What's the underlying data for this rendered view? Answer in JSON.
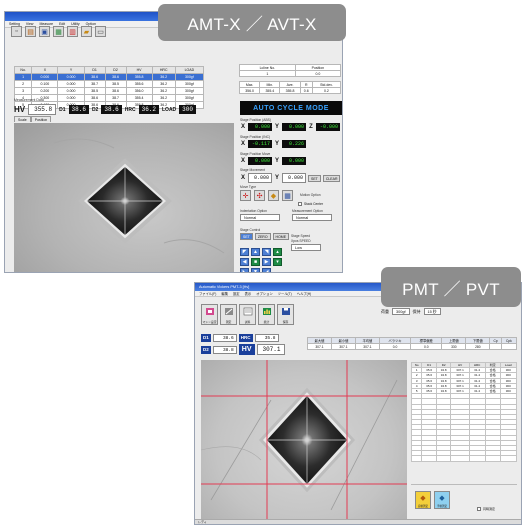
{
  "labels": {
    "top": "AMT-X ／ AVT-X",
    "bottom": "PMT ／ PVT"
  },
  "shot1": {
    "menu": [
      "Setting",
      "View",
      "Measure",
      "Edit",
      "Utility",
      "Option"
    ],
    "table_headers": [
      "No.",
      "X",
      "Y",
      "D1",
      "D2",
      "HV",
      "HRC",
      "LOAD"
    ],
    "table_rows": [
      [
        "1",
        "0.000",
        "0.000",
        "38.6",
        "38.6",
        "355.8",
        "36.2",
        "300gf"
      ],
      [
        "2",
        "0.100",
        "0.000",
        "38.7",
        "38.5",
        "355.6",
        "36.2",
        "300gf"
      ],
      [
        "3",
        "0.200",
        "0.000",
        "38.5",
        "38.6",
        "356.0",
        "36.2",
        "300gf"
      ],
      [
        "4",
        "0.300",
        "0.000",
        "38.6",
        "38.7",
        "355.4",
        "36.2",
        "300gf"
      ],
      [
        "5",
        "0.400",
        "0.000",
        "38.6",
        "38.6",
        "355.8",
        "36.2",
        "300gf"
      ]
    ],
    "stat_rows": [
      [
        "Lcline No.",
        "Position"
      ],
      [
        "1",
        "0.0"
      ],
      [
        "Max.",
        "Min.",
        "Ave.",
        "R",
        "Std.dev."
      ],
      [
        "356.0",
        "355.4",
        "355.8",
        "0.6",
        "0.2"
      ]
    ],
    "meas_title": "Measurement Data",
    "hv_label": "HV",
    "hv_value": "355.8",
    "d1_label": "D1",
    "d1_value": "38.6",
    "d2_label": "D2",
    "d2_value": "38.6",
    "hrc_label": "HRC",
    "hrc_value": "36.2",
    "load_label": "LOAD",
    "load_value": "300",
    "tabs": [
      "Scale",
      "Position"
    ],
    "banner": "AUTO CYCLE MODE",
    "stage_abs_title": "Stage Position (ABS)",
    "stage_inc_title": "Stage Position (INC)",
    "stage_move_title": "Stage Position Move",
    "stage_mov2_title": "Stage Movement",
    "abs": {
      "x": "0.000",
      "y": "0.000",
      "z": "-0.000"
    },
    "inc": {
      "x": "-0.117",
      "y": "0.226"
    },
    "move": {
      "x": "0.000",
      "y": "0.000"
    },
    "mov2": {
      "x": "0.000",
      "y": "0.000",
      "b1": "SET",
      "b2": "CLEAR"
    },
    "move_type_title": "Move Type",
    "motion_title": "Motion Option",
    "check_label": "Stack Center",
    "indent_title": "Indentation Option",
    "indent_value": "Normal",
    "meas_opt_title": "Measurement Option",
    "meas_opt_value": "Normal",
    "stage_ctrl_title": "Stage Control",
    "stage_btns": [
      "SET",
      "ZERO",
      "HOME"
    ],
    "speed_title": "Stage Speed",
    "speed_label": "Xpos SPEED",
    "speed_value": "Low"
  },
  "shot2": {
    "title": "Automatic Vickers PMT-3 [Hv]",
    "menu": [
      "ファイル(F)",
      "編集",
      "設定",
      "表示",
      "オプション",
      "ツール(T)",
      "ヘルプ(H)"
    ],
    "tools": [
      "マシン設定",
      "測定",
      "試料",
      "統計",
      "保存"
    ],
    "cond_label": "荷重",
    "cond_value": "300gf",
    "cond_label2": "保持",
    "cond_value2": "15 秒",
    "d1_label": "D1",
    "d1_value": "38.6",
    "d2_label": "D2",
    "d2_value": "38.8",
    "hrc_label": "HRC",
    "hrc_value": "35.8",
    "hv_label": "HV",
    "hv_value": "307.1",
    "stat_headers": [
      "最大値",
      "最小値",
      "平均値",
      "バラツキ",
      "標準偏差",
      "上限値",
      "下限値",
      "Cp",
      "Cpk"
    ],
    "stat_values": [
      "307.1",
      "307.1",
      "307.1",
      "0.0",
      "0.0",
      "330",
      "280",
      "",
      ""
    ],
    "table_headers": [
      "No",
      "D1",
      "D2",
      "HV",
      "HRC",
      "判定",
      "Load"
    ],
    "table_rows": [
      [
        "1",
        "35.6",
        "34.8",
        "307.1",
        "31.4",
        "合格",
        "300"
      ],
      [
        "2",
        "35.6",
        "34.8",
        "307.1",
        "31.4",
        "合格",
        "300"
      ],
      [
        "3",
        "35.6",
        "34.8",
        "307.1",
        "31.4",
        "合格",
        "300"
      ],
      [
        "4",
        "35.6",
        "34.8",
        "307.1",
        "31.4",
        "合格",
        "300"
      ],
      [
        "5",
        "35.6",
        "34.8",
        "307.1",
        "31.4",
        "合格",
        "300"
      ]
    ],
    "bottom_btns": [
      "自動測定",
      "手動測定"
    ],
    "checkbox": "同時測定",
    "status": "レディ"
  }
}
